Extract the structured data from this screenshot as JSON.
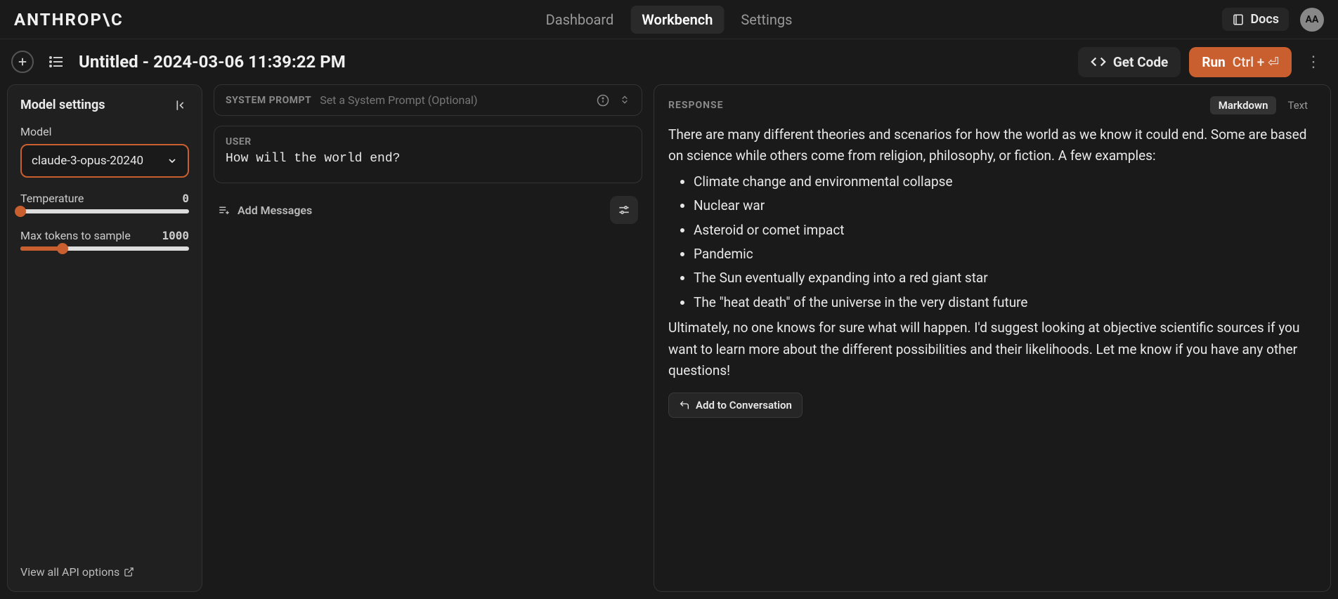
{
  "brand": "ANTHROP\\C",
  "nav": {
    "dashboard": "Dashboard",
    "workbench": "Workbench",
    "settings": "Settings"
  },
  "header": {
    "docs": "Docs",
    "avatar": "AA"
  },
  "toolbar": {
    "title": "Untitled - 2024-03-06 11:39:22 PM",
    "get_code": "Get Code",
    "run": "Run",
    "run_shortcut": "Ctrl + ⏎"
  },
  "sidebar": {
    "title": "Model settings",
    "model_label": "Model",
    "model_value": "claude-3-opus-20240",
    "temperature_label": "Temperature",
    "temperature_value": "0",
    "max_tokens_label": "Max tokens to sample",
    "max_tokens_value": "1000",
    "view_all": "View all API options"
  },
  "prompt": {
    "system_label": "SYSTEM PROMPT",
    "system_placeholder": "Set a System Prompt (Optional)",
    "user_label": "USER",
    "user_text": "How will the world end?",
    "add_messages": "Add Messages"
  },
  "response": {
    "label": "RESPONSE",
    "tab_markdown": "Markdown",
    "tab_text": "Text",
    "intro": "There are many different theories and scenarios for how the world as we know it could end. Some are based on science while others come from religion, philosophy, or fiction. A few examples:",
    "bullets": [
      "Climate change and environmental collapse",
      "Nuclear war",
      "Asteroid or comet impact",
      "Pandemic",
      "The Sun eventually expanding into a red giant star",
      "The \"heat death\" of the universe in the very distant future"
    ],
    "outro": "Ultimately, no one knows for sure what will happen. I'd suggest looking at objective scientific sources if you want to learn more about the different possibilities and their likelihoods. Let me know if you have any other questions!",
    "add_to_conv": "Add to Conversation"
  },
  "colors": {
    "accent": "#c95f2f",
    "bg": "#1a1a1a",
    "panel": "#202020"
  }
}
